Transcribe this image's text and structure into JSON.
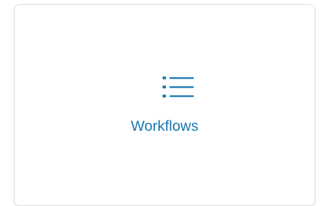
{
  "card": {
    "label": "Workflows",
    "icon": "list-icon",
    "accent_color": "#1979b3"
  }
}
